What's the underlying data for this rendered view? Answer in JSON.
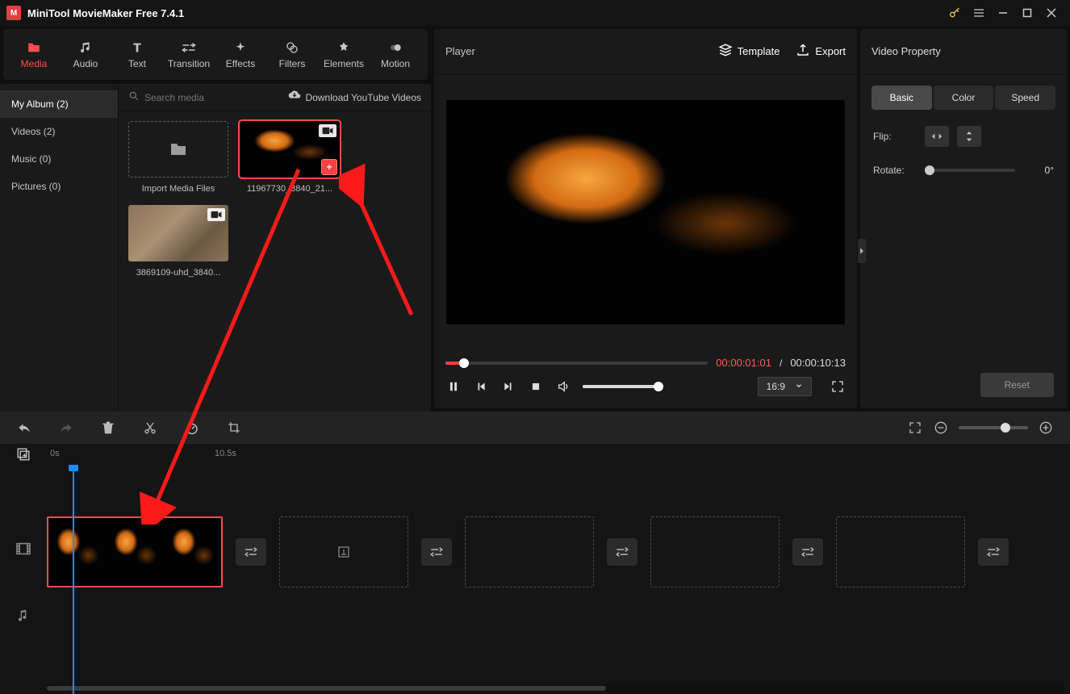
{
  "app": {
    "title": "MiniTool MovieMaker Free 7.4.1"
  },
  "tool_tabs": [
    {
      "label": "Media",
      "icon": "folder-icon",
      "active": true
    },
    {
      "label": "Audio",
      "icon": "music-note-icon"
    },
    {
      "label": "Text",
      "icon": "text-icon"
    },
    {
      "label": "Transition",
      "icon": "transition-icon"
    },
    {
      "label": "Effects",
      "icon": "sparkle-icon"
    },
    {
      "label": "Filters",
      "icon": "filters-icon"
    },
    {
      "label": "Elements",
      "icon": "elements-icon"
    },
    {
      "label": "Motion",
      "icon": "motion-icon"
    }
  ],
  "albums": [
    {
      "label": "My Album (2)",
      "active": true
    },
    {
      "label": "Videos (2)"
    },
    {
      "label": "Music (0)"
    },
    {
      "label": "Pictures (0)"
    }
  ],
  "search": {
    "placeholder": "Search media"
  },
  "download_yt": "Download YouTube Videos",
  "media_items": [
    {
      "type": "import",
      "label": "Import Media Files"
    },
    {
      "type": "video",
      "label": "11967730_3840_21...",
      "selected": true,
      "add_visible": true
    },
    {
      "type": "video",
      "label": "3869109-uhd_3840..."
    }
  ],
  "player": {
    "title": "Player",
    "template_btn": "Template",
    "export_btn": "Export",
    "time_current": "00:00:01:01",
    "time_separator": " / ",
    "time_total": "00:00:10:13",
    "aspect": "16:9"
  },
  "property": {
    "title": "Video Property",
    "tabs": [
      {
        "label": "Basic",
        "active": true
      },
      {
        "label": "Color"
      },
      {
        "label": "Speed"
      }
    ],
    "flip_label": "Flip:",
    "rotate_label": "Rotate:",
    "rotate_value": "0°",
    "reset": "Reset"
  },
  "ruler": {
    "t0": "0s",
    "t1": "10.5s"
  }
}
